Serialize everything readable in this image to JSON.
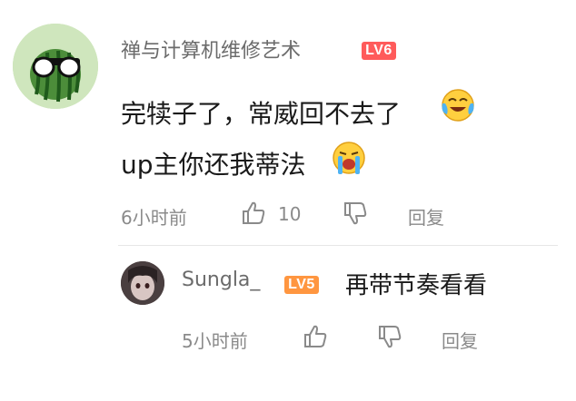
{
  "colors": {
    "level6_badge": "#ff5b5b",
    "level5_badge": "#ff9640",
    "username": "#6b6b6b",
    "meta_text": "#8a8a8a",
    "body_text": "#1a1a1a"
  },
  "comment": {
    "username": "禅与计算机维修艺术",
    "level": "LV6",
    "text_line1": "完犊子了，常威回不去了",
    "text_line2": "up主你还我蒂法",
    "emojis": [
      "laughing-crying-emoji",
      "crying-emoji"
    ],
    "time": "6小时前",
    "like_count": "10",
    "reply_label": "回复"
  },
  "reply": {
    "username": "Sungla_",
    "level": "LV5",
    "text": "再带节奏看看",
    "time": "5小时前",
    "reply_label": "回复"
  },
  "icons": {
    "like": "thumbs-up-icon",
    "dislike": "thumbs-down-icon"
  }
}
